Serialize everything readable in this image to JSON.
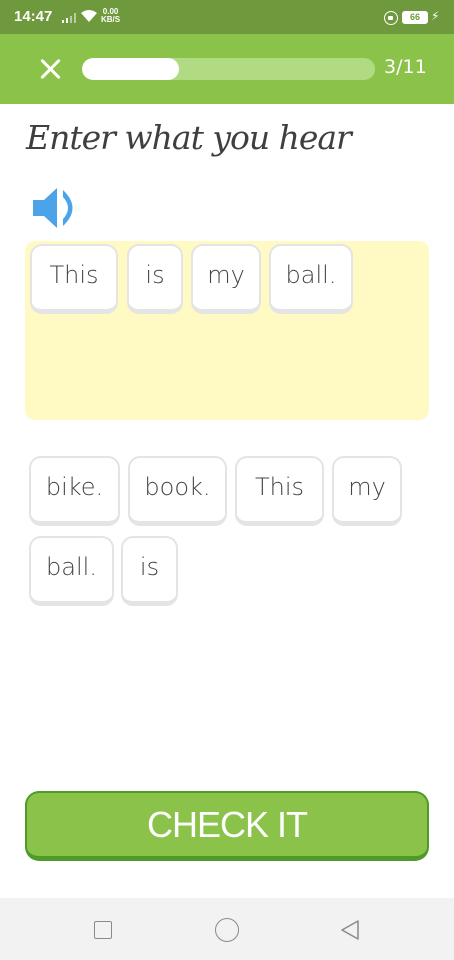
{
  "status_bar": {
    "time": "14:47",
    "net_speed_value": "0.00",
    "net_speed_unit": "KB/S",
    "battery": "66",
    "icons": [
      "signal-icon",
      "wifi-icon",
      "lock-icon",
      "battery-icon",
      "charging-icon"
    ]
  },
  "header": {
    "progress_text": "3/11",
    "progress_fraction": 0.33,
    "icons": [
      "close-icon"
    ]
  },
  "title": "Enter what you hear",
  "speaker": {
    "icon": "speaker-icon",
    "color": "#4da3e8"
  },
  "answer_words": [
    "This",
    "is",
    "my",
    "ball."
  ],
  "word_bank": [
    "bike.",
    "book.",
    "This",
    "my",
    "ball.",
    "is"
  ],
  "check_button": {
    "label": "CHECK IT"
  },
  "colors": {
    "header_green": "#8bc34a",
    "status_green": "#6e9a3d",
    "answer_area": "#fff9c4",
    "button_border": "#4e9a2a"
  },
  "nav_bar": {
    "icons": [
      "recents-icon",
      "home-icon",
      "back-icon"
    ]
  }
}
